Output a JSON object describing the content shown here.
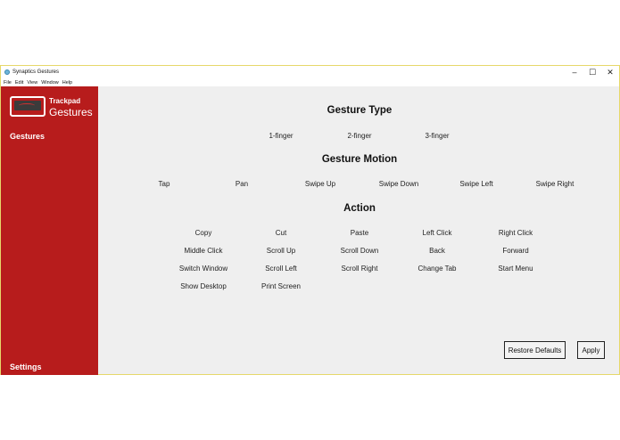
{
  "window": {
    "title": "Synaptics Gestures",
    "controls": {
      "minimize": "–",
      "maximize": "☐",
      "close": "✕"
    }
  },
  "menu": [
    "File",
    "Edit",
    "View",
    "Window",
    "Help"
  ],
  "sidebar": {
    "logo_small": "Trackpad",
    "logo_big": "Gestures",
    "gestures_label": "Gestures",
    "settings_label": "Settings"
  },
  "gesture_type": {
    "title": "Gesture Type",
    "options": [
      "1-finger",
      "2-finger",
      "3-finger"
    ]
  },
  "gesture_motion": {
    "title": "Gesture Motion",
    "options": [
      "Tap",
      "Pan",
      "Swipe Up",
      "Swipe Down",
      "Swipe Left",
      "Swipe Right"
    ]
  },
  "action": {
    "title": "Action",
    "options": [
      [
        "Copy",
        "Cut",
        "Paste",
        "Left Click",
        "Right Click"
      ],
      [
        "Middle Click",
        "Scroll Up",
        "Scroll Down",
        "Back",
        "Forward"
      ],
      [
        "Switch Window",
        "Scroll Left",
        "Scroll Right",
        "Change Tab",
        "Start Menu"
      ],
      [
        "Show Desktop",
        "Print Screen"
      ]
    ]
  },
  "buttons": {
    "restore": "Restore Defaults",
    "apply": "Apply"
  }
}
